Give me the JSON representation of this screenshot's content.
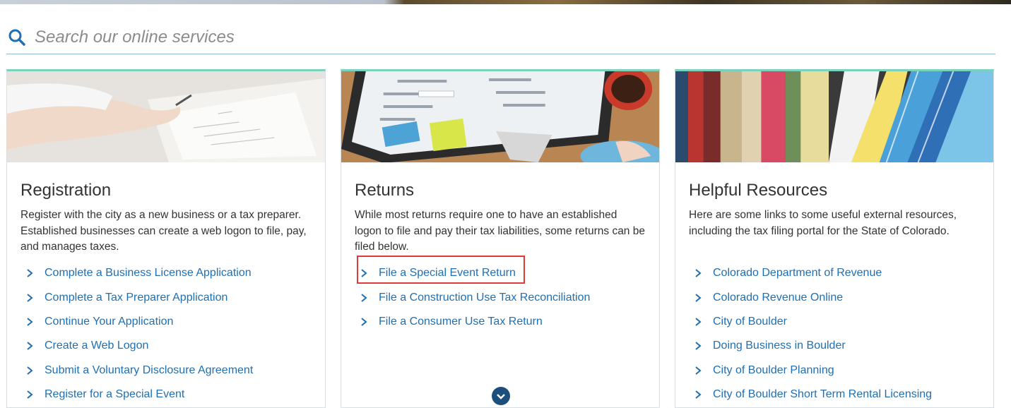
{
  "search": {
    "placeholder": "Search our online services"
  },
  "cards": [
    {
      "title": "Registration",
      "description": "Register with the city as a new business or a tax preparer. Established businesses can create a web logon to file, pay, and manages taxes.",
      "image_icon": "signing-document-photo",
      "links": [
        "Complete a Business License Application",
        "Complete a Tax Preparer Application",
        "Continue Your Application",
        "Create a Web Logon",
        "Submit a Voluntary Disclosure Agreement",
        "Register for a Special Event"
      ]
    },
    {
      "title": "Returns",
      "description": "While most returns require one to have an established logon to file and pay their tax liabilities, some returns can be filed below.",
      "image_icon": "computer-form-desk-photo",
      "links": [
        "File a Special Event Return",
        "File a Construction Use Tax Reconciliation",
        "File a Consumer Use Tax Return"
      ]
    },
    {
      "title": "Helpful Resources",
      "description": "Here are some links to some useful external resources, including the tax filing portal for the State of Colorado.",
      "image_icon": "binders-folders-photo",
      "links": [
        "Colorado Department of Revenue",
        "Colorado Revenue Online",
        "City of Boulder",
        "Doing Business in Boulder",
        "City of Boulder Planning",
        "City of Boulder Short Term Rental Licensing"
      ]
    }
  ],
  "colors": {
    "accent": "#7ad1bc",
    "link": "#1f6fb2",
    "highlight": "#e03a3a",
    "search_icon": "#1f6fb2"
  }
}
